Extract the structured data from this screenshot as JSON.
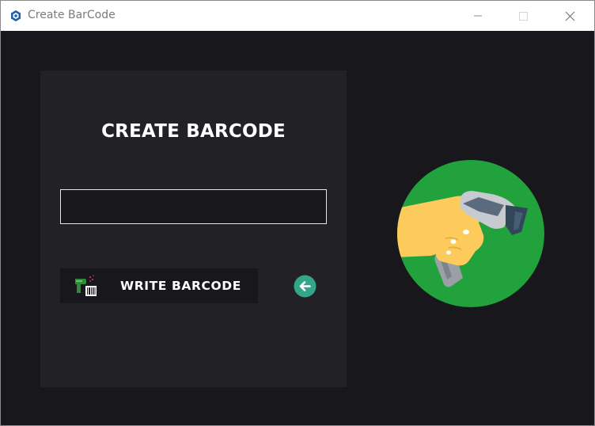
{
  "window": {
    "title": "Create BarCode",
    "icons": {
      "app": "app-logo-icon",
      "minimize": "minimize-icon",
      "maximize": "maximize-icon",
      "close": "close-icon"
    }
  },
  "panel": {
    "heading": "CREATE BARCODE",
    "input": {
      "value": "",
      "placeholder": ""
    },
    "write_button": {
      "label": "WRITE BARCODE",
      "icon": "barcode-scanner-icon"
    },
    "back_button": {
      "icon": "arrow-left-icon"
    }
  },
  "illustration": {
    "icon": "hand-scanner-illustration"
  },
  "colors": {
    "client_bg": "#18171c",
    "panel_bg": "#222126",
    "accent_green": "#21a23c",
    "back_button_teal": "#35a589",
    "hand_yellow": "#fccb5c"
  }
}
